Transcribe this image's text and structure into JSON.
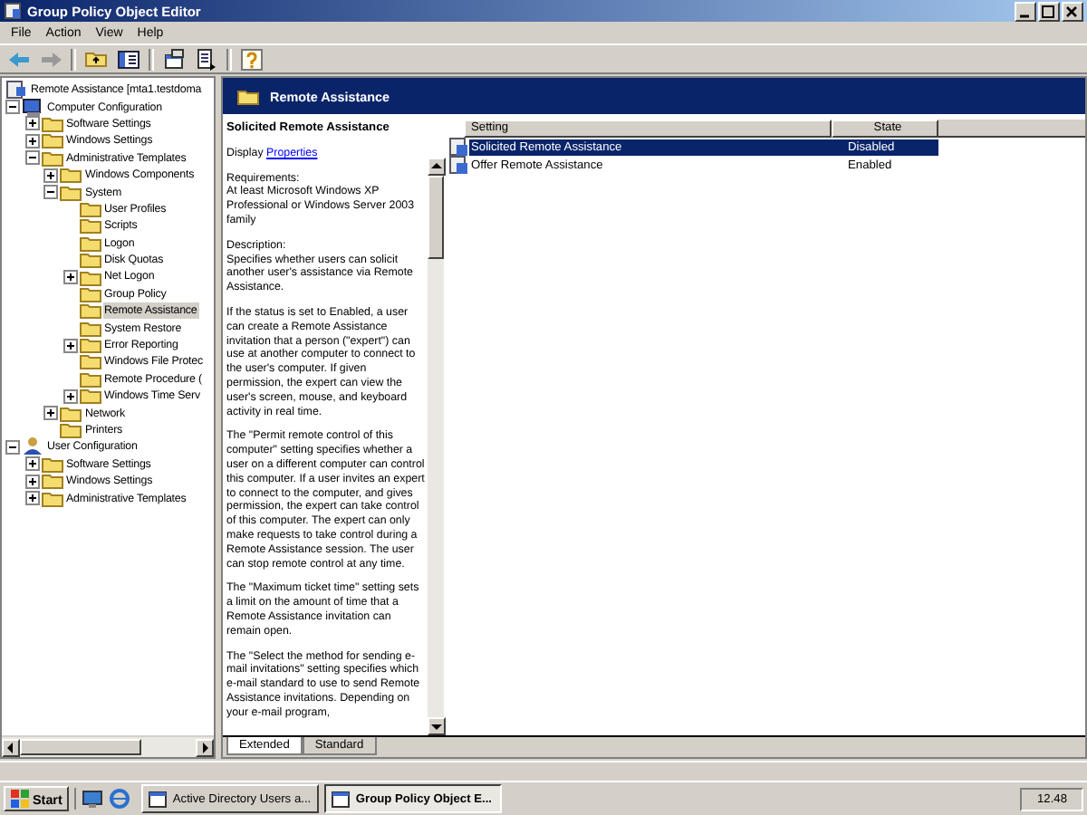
{
  "window": {
    "title": "Group Policy Object Editor"
  },
  "menu": [
    "File",
    "Action",
    "View",
    "Help"
  ],
  "tree": [
    {
      "label": "Remote Assistance [mta1.testdoma",
      "kind": "policy",
      "selected": false,
      "children": [
        {
          "label": "Computer Configuration",
          "kind": "computer",
          "expanded": true,
          "selected": false,
          "children": [
            {
              "label": "Software Settings",
              "kind": "folder",
              "expanded": false,
              "selected": false
            },
            {
              "label": "Windows Settings",
              "kind": "folder",
              "expanded": false,
              "selected": false
            },
            {
              "label": "Administrative Templates",
              "kind": "folder",
              "expanded": true,
              "selected": false,
              "children": [
                {
                  "label": "Windows Components",
                  "kind": "folder",
                  "expanded": false,
                  "selected": false
                },
                {
                  "label": "System",
                  "kind": "folder",
                  "expanded": true,
                  "selected": false,
                  "children": [
                    {
                      "label": "User Profiles",
                      "kind": "folder",
                      "selected": false
                    },
                    {
                      "label": "Scripts",
                      "kind": "folder",
                      "selected": false
                    },
                    {
                      "label": "Logon",
                      "kind": "folder",
                      "selected": false
                    },
                    {
                      "label": "Disk Quotas",
                      "kind": "folder",
                      "selected": false
                    },
                    {
                      "label": "Net Logon",
                      "kind": "folder",
                      "expanded": false,
                      "selected": false
                    },
                    {
                      "label": "Group Policy",
                      "kind": "folder",
                      "selected": false
                    },
                    {
                      "label": "Remote Assistance",
                      "kind": "folder",
                      "selected": true
                    },
                    {
                      "label": "System Restore",
                      "kind": "folder",
                      "selected": false
                    },
                    {
                      "label": "Error Reporting",
                      "kind": "folder",
                      "expanded": false,
                      "selected": false
                    },
                    {
                      "label": "Windows File Protec",
                      "kind": "folder",
                      "selected": false
                    },
                    {
                      "label": "Remote Procedure (",
                      "kind": "folder",
                      "selected": false
                    },
                    {
                      "label": "Windows Time Serv",
                      "kind": "folder",
                      "expanded": false,
                      "selected": false
                    }
                  ]
                },
                {
                  "label": "Network",
                  "kind": "folder",
                  "expanded": false,
                  "selected": false
                },
                {
                  "label": "Printers",
                  "kind": "folder",
                  "selected": false
                }
              ]
            }
          ]
        },
        {
          "label": "User Configuration",
          "kind": "user",
          "expanded": true,
          "selected": false,
          "children": [
            {
              "label": "Software Settings",
              "kind": "folder",
              "expanded": false,
              "selected": false
            },
            {
              "label": "Windows Settings",
              "kind": "folder",
              "expanded": false,
              "selected": false
            },
            {
              "label": "Administrative Templates",
              "kind": "folder",
              "expanded": false,
              "selected": false
            }
          ]
        }
      ]
    }
  ],
  "header": {
    "title": "Remote Assistance"
  },
  "description": {
    "title": "Solicited Remote Assistance",
    "display_label": "Display",
    "display_link": "Properties",
    "paragraphs": [
      "Requirements:\nAt least Microsoft Windows XP Professional or Windows Server 2003 family",
      "Description:\nSpecifies whether users can solicit another user's assistance via Remote Assistance.",
      "If the status is set to Enabled, a user can create a Remote Assistance invitation that a person (\"expert\") can use at another computer to connect to the user's computer. If given permission, the expert can view the user's screen, mouse, and keyboard activity in real time.",
      "The \"Permit remote control of this computer\" setting specifies whether a user on a different computer can control this computer.  If a user invites an expert to connect to the computer, and gives permission, the expert can take control of this computer. The expert can only make requests to take control during a Remote Assistance session. The user can stop remote control at any time.",
      "The \"Maximum ticket time\" setting sets a limit on the amount of time that a Remote Assistance invitation can remain open.",
      "The \"Select the method for sending e-mail invitations\" setting specifies which e-mail standard to use to send Remote Assistance invitations. Depending on your e-mail program,"
    ]
  },
  "settings": {
    "columns": [
      "Setting",
      "State"
    ],
    "rows": [
      {
        "setting": "Solicited Remote Assistance",
        "state": "Disabled",
        "selected": true
      },
      {
        "setting": "Offer Remote Assistance",
        "state": "Enabled",
        "selected": false
      }
    ]
  },
  "tabs": [
    {
      "label": "Extended",
      "selected": true
    },
    {
      "label": "Standard",
      "selected": false
    }
  ],
  "taskbar": {
    "start": "Start",
    "tasks": [
      {
        "label": "Active Directory Users a...",
        "selected": false
      },
      {
        "label": "Group Policy Object E...",
        "selected": true
      }
    ],
    "clock": "12.48"
  }
}
